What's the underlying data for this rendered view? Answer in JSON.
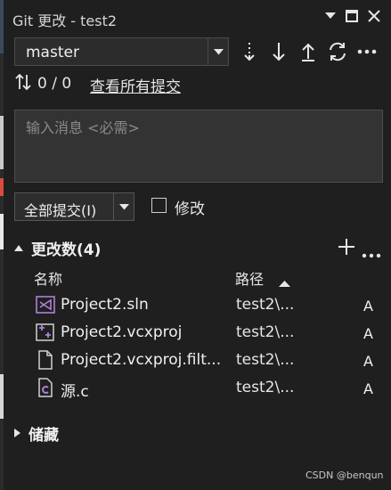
{
  "colors": {
    "background": "#1f1f1f",
    "input_background": "#333333",
    "border": "#4f4f4f",
    "text": "#e6e6e6",
    "vs_purple": "#b180d7"
  },
  "window": {
    "title": "Git 更改 - test2",
    "icons": [
      "dropdown-arrow-icon",
      "maximize-icon",
      "close-icon"
    ]
  },
  "branch": {
    "selected": "master",
    "toolbar_icons": [
      "fetch-icon",
      "pull-icon",
      "push-icon",
      "sync-icon",
      "more-icon"
    ]
  },
  "sync": {
    "count": "0 / 0",
    "view_all_link": "查看所有提交"
  },
  "message": {
    "placeholder": "输入消息 <必需>"
  },
  "commit": {
    "label": "全部提交(I)",
    "amend_label": "修改"
  },
  "changes": {
    "header": "更改数(4)",
    "col_name": "名称",
    "col_path": "路径",
    "files": [
      {
        "name": "Project2.sln",
        "path": "test2\\...",
        "status": "A",
        "icon": "solution-file-icon"
      },
      {
        "name": "Project2.vcxproj",
        "path": "test2\\...",
        "status": "A",
        "icon": "cpp-project-icon"
      },
      {
        "name": "Project2.vcxproj.filt...",
        "path": "test2\\...",
        "status": "A",
        "icon": "document-file-icon"
      },
      {
        "name": "源.c",
        "path": "test2\\...",
        "status": "A",
        "icon": "c-source-file-icon"
      }
    ]
  },
  "stash": {
    "header": "储藏"
  },
  "watermark": "CSDN @benqun"
}
